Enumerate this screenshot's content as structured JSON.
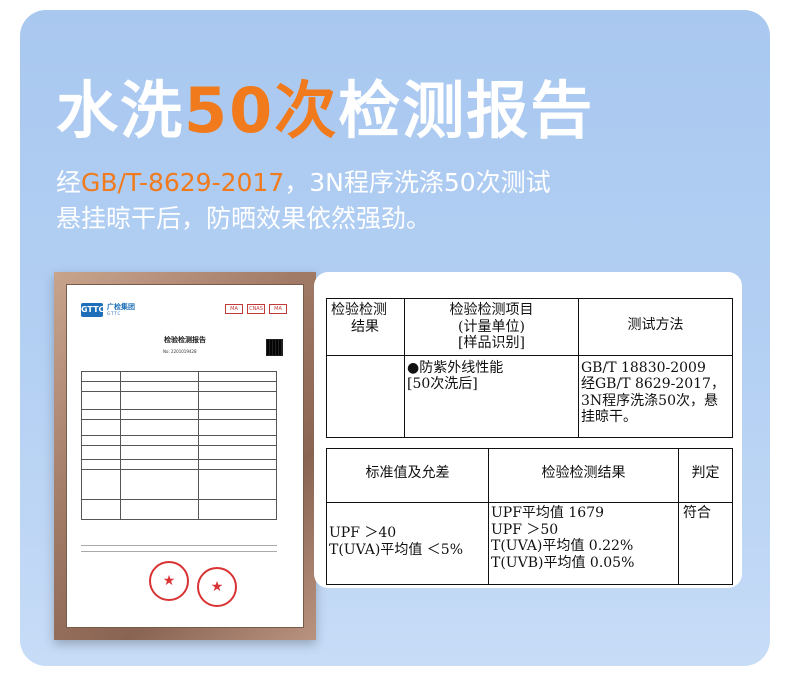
{
  "headline": {
    "part1": "水洗",
    "highlight": "50次",
    "part2": "检测报告"
  },
  "subtitle": {
    "line1_prefix": "经",
    "line1_highlight": "GB/T-8629-2017",
    "line1_rest": "，3N程序洗涤50次测试",
    "line2": "悬挂晾干后，防晒效果依然强劲。"
  },
  "certificate": {
    "logo_mark": "GTTC",
    "logo_name": "广检集团",
    "logo_sub": "GTTC",
    "badges": [
      "MA",
      "CNAS",
      "MA"
    ],
    "title": "检验检测报告",
    "report_no": "No: 2201019428",
    "seal_symbol": "★"
  },
  "report": {
    "top_headers": {
      "col1": [
        "检验检测",
        "结果"
      ],
      "col2": [
        "检验检测项目",
        "(计量单位)",
        "[样品识别]"
      ],
      "col3": "测试方法"
    },
    "item": {
      "name": "●防紫外线性能",
      "sample": "[50次洗后]"
    },
    "method": [
      "GB/T 18830-2009",
      "经GB/T 8629-2017，",
      "3N程序洗涤50次，悬",
      "挂晾干。"
    ],
    "bottom_headers": {
      "standard": "标准值及允差",
      "result": "检验检测结果",
      "verdict": "判定"
    },
    "standard_values": [
      "UPF ＞40",
      "T(UVA)平均值 ＜5%"
    ],
    "result_values": [
      "UPF平均值 1679",
      "UPF ＞50",
      "T(UVA)平均值 0.22%",
      "T(UVB)平均值 0.05%"
    ],
    "verdict_value": "符合"
  },
  "colors": {
    "background": "#b4d0f3",
    "highlight": "#f07a1c",
    "text": "#ffffff"
  }
}
